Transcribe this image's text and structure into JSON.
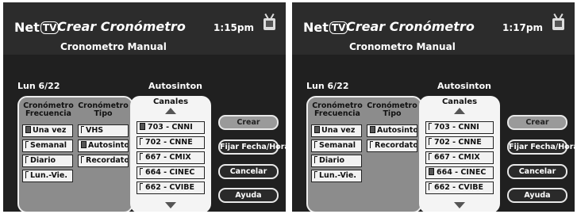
{
  "screens": [
    {
      "logo": {
        "net": "Net",
        "tv": "TV"
      },
      "title": "Crear Cronómetro",
      "time": "1:15pm",
      "subtitle": "Cronometro Manual",
      "date": "Lun 6/22",
      "autosinton": "Autosinton",
      "freq_header": "Cronómetro Frecuencia",
      "tipo_header": "Cronómetro Tipo",
      "freq_options": [
        {
          "label": "Una vez",
          "checked": true
        },
        {
          "label": "Semanal",
          "checked": false
        },
        {
          "label": "Diario",
          "checked": false
        },
        {
          "label": "Lun.-Vie.",
          "checked": false
        }
      ],
      "tipo_options": [
        {
          "label": "VHS",
          "checked": false
        },
        {
          "label": "Autosinton",
          "checked": true
        },
        {
          "label": "Recordator",
          "checked": false
        }
      ],
      "channels_header": "Canales",
      "channels": [
        {
          "label": "703 - CNNI",
          "checked": true
        },
        {
          "label": "702 - CNNE",
          "checked": false
        },
        {
          "label": "667 - CMIX",
          "checked": false
        },
        {
          "label": "664 - CINEC",
          "checked": false
        },
        {
          "label": "662 - CVIBE",
          "checked": false
        }
      ],
      "buttons": {
        "crear": "Crear",
        "fijar": "Fijar Fecha/Hora",
        "cancelar": "Cancelar",
        "ayuda": "Ayuda"
      },
      "selected_button": "crear"
    },
    {
      "logo": {
        "net": "Net",
        "tv": "TV"
      },
      "title": "Crear Cronómetro",
      "time": "1:17pm",
      "subtitle": "Cronometro Manual",
      "date": "Lun 6/22",
      "autosinton": "Autosinton",
      "freq_header": "Cronómetro Frecuencia",
      "tipo_header": "Cronómetro Tipo",
      "freq_options": [
        {
          "label": "Una vez",
          "checked": true
        },
        {
          "label": "Semanal",
          "checked": false
        },
        {
          "label": "Diario",
          "checked": false
        },
        {
          "label": "Lun.-Vie.",
          "checked": false
        }
      ],
      "tipo_options": [
        {
          "label": "Autosinton",
          "checked": true
        },
        {
          "label": "Recordator",
          "checked": false
        }
      ],
      "channels_header": "Canales",
      "channels": [
        {
          "label": "703 - CNNI",
          "checked": false
        },
        {
          "label": "702 - CNNE",
          "checked": false
        },
        {
          "label": "667 - CMIX",
          "checked": false
        },
        {
          "label": "664 - CINEC",
          "checked": true
        },
        {
          "label": "662 - CVIBE",
          "checked": false
        }
      ],
      "buttons": {
        "crear": "Crear",
        "fijar": "Fijar Fecha/Hora",
        "cancelar": "Cancelar",
        "ayuda": "Ayuda"
      },
      "selected_button": "crear"
    }
  ]
}
